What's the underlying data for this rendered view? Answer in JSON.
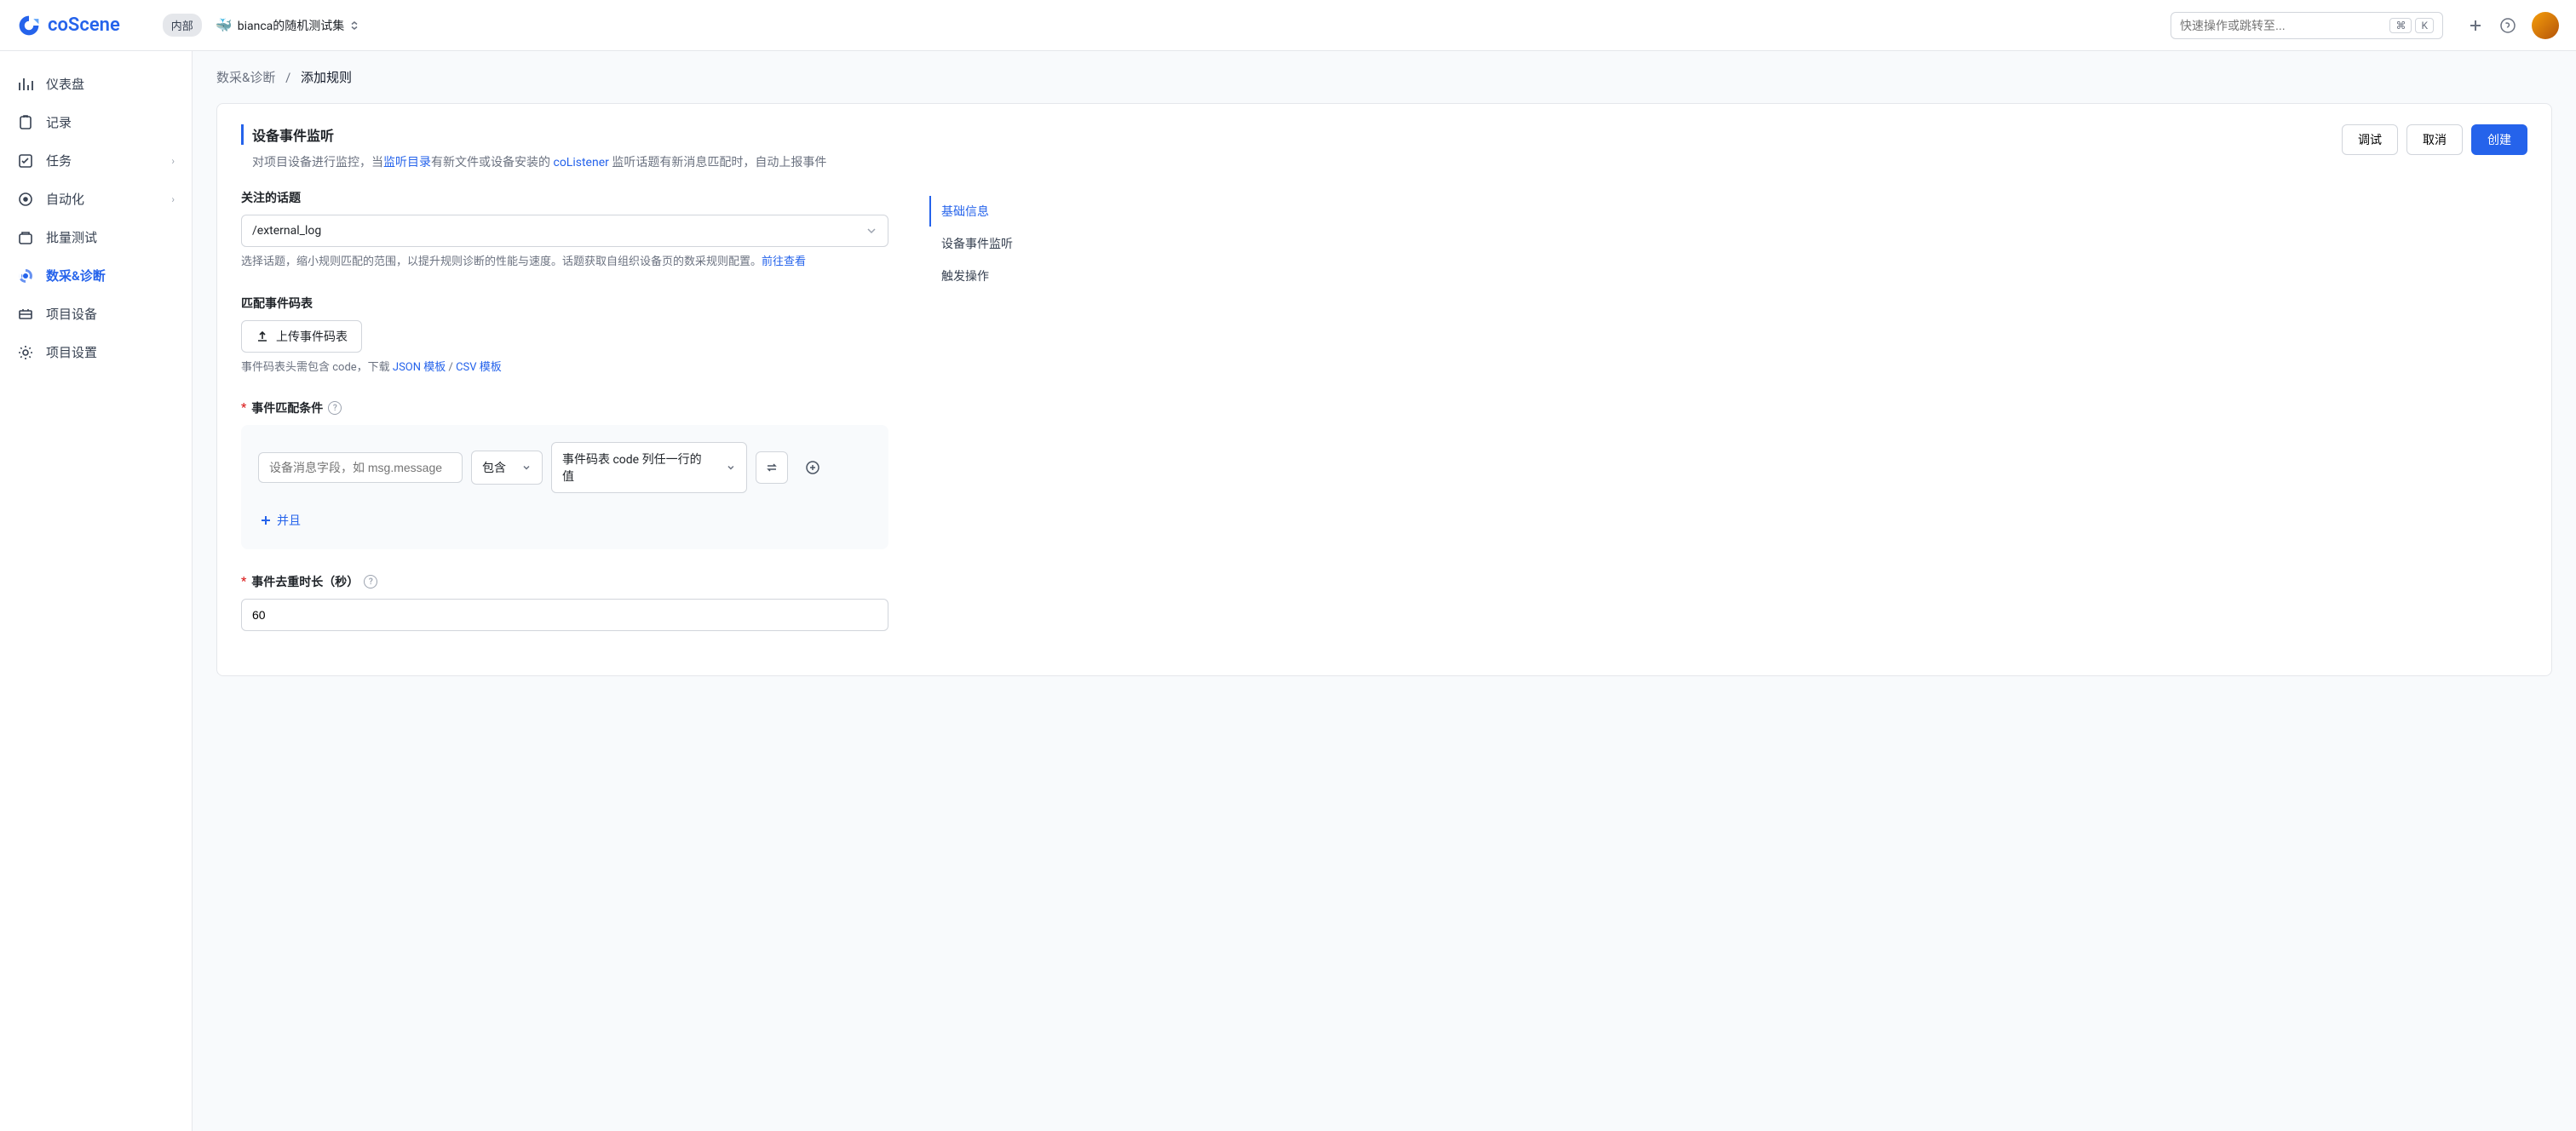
{
  "header": {
    "logo": "coScene",
    "badge": "内部",
    "project": "bianca的随机测试集",
    "search_placeholder": "快速操作或跳转至...",
    "kbd1": "⌘",
    "kbd2": "K"
  },
  "sidebar": {
    "items": [
      {
        "label": "仪表盘",
        "icon": "dashboard"
      },
      {
        "label": "记录",
        "icon": "records"
      },
      {
        "label": "任务",
        "icon": "tasks",
        "expandable": true
      },
      {
        "label": "自动化",
        "icon": "automation",
        "expandable": true
      },
      {
        "label": "批量测试",
        "icon": "batch"
      },
      {
        "label": "数采&诊断",
        "icon": "diagnosis",
        "active": true
      },
      {
        "label": "项目设备",
        "icon": "devices"
      },
      {
        "label": "项目设置",
        "icon": "settings"
      }
    ]
  },
  "breadcrumb": {
    "parent": "数采&诊断",
    "current": "添加规则"
  },
  "page": {
    "title": "设备事件监听",
    "desc_prefix": "对项目设备进行监控，当",
    "desc_link1": "监听目录",
    "desc_mid1": "有新文件或设备安装的 ",
    "desc_link2": "coListener",
    "desc_suffix": " 监听话题有新消息匹配时，自动上报事件",
    "actions": {
      "debug": "调试",
      "cancel": "取消",
      "create": "创建"
    }
  },
  "form_nav": {
    "items": [
      {
        "label": "基础信息",
        "active": true
      },
      {
        "label": "设备事件监听"
      },
      {
        "label": "触发操作"
      }
    ]
  },
  "fields": {
    "topic": {
      "label": "关注的话题",
      "value": "/external_log",
      "help_prefix": "选择话题，缩小规则匹配的范围，以提升规则诊断的性能与速度。话题获取自组织设备页的数采规则配置。",
      "help_link": "前往查看"
    },
    "codeTable": {
      "label": "匹配事件码表",
      "upload": "上传事件码表",
      "help_prefix": "事件码表头需包含 code，下载 ",
      "help_link1": "JSON 模板",
      "help_sep": " / ",
      "help_link2": "CSV 模板"
    },
    "condition": {
      "label": "事件匹配条件",
      "placeholder": "设备消息字段，如 msg.message",
      "operator": "包含",
      "value_select": "事件码表 code 列任一行的值",
      "add_and": "并且"
    },
    "dedup": {
      "label": "事件去重时长（秒）",
      "value": "60"
    }
  }
}
